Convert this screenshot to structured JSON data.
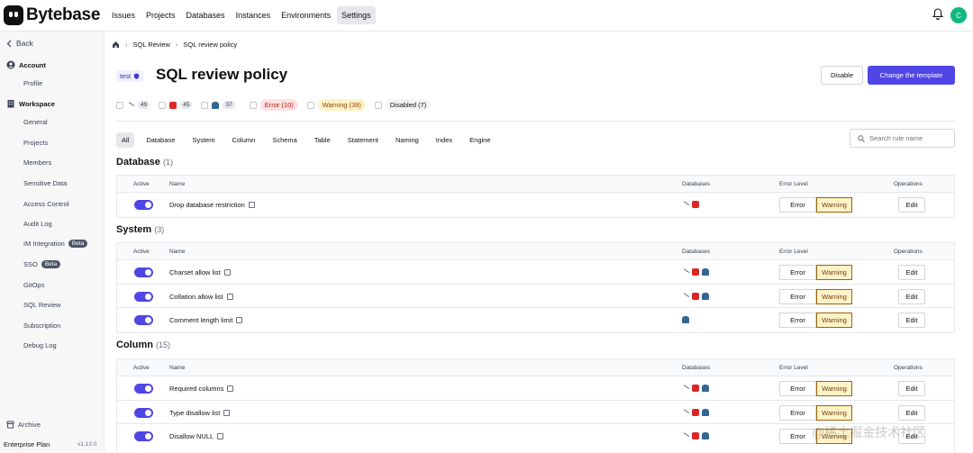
{
  "app": {
    "name": "Bytebase",
    "avatar_letter": "C",
    "accent": "#4f46e5"
  },
  "nav": {
    "items": [
      "Issues",
      "Projects",
      "Databases",
      "Instances",
      "Environments",
      "Settings"
    ],
    "active": "Settings"
  },
  "sidebar": {
    "back": "Back",
    "account": "Account",
    "profile": "Profile",
    "workspace": "Workspace",
    "items": [
      "General",
      "Projects",
      "Members",
      "Sensitive Data",
      "Access Control",
      "Audit Log",
      "IM Integration",
      "SSO",
      "GitOps",
      "SQL Review",
      "Subscription",
      "Debug Log"
    ],
    "beta_label": "Beta",
    "archive": "Archive",
    "plan": "Enterprise Plan",
    "version": "v1.13.0"
  },
  "breadcrumb": {
    "items": [
      "SQL Review",
      "SQL review policy"
    ]
  },
  "page": {
    "env_tag": "test",
    "title": "SQL review policy",
    "disable_label": "Disable",
    "change_label": "Change the template"
  },
  "filters": {
    "engines": [
      {
        "icon": "mysql-icon",
        "count": "49"
      },
      {
        "icon": "tidb-icon",
        "count": "45"
      },
      {
        "icon": "postgres-icon",
        "count": "37"
      }
    ],
    "levels": {
      "error": "Error (10)",
      "warning": "Warning (38)",
      "disabled": "Disabled (7)"
    }
  },
  "tabs": [
    "All",
    "Database",
    "System",
    "Column",
    "Schema",
    "Table",
    "Statement",
    "Naming",
    "Index",
    "Engine"
  ],
  "search": {
    "placeholder": "Search rule name"
  },
  "table_headers": {
    "active": "Active",
    "name": "Name",
    "databases": "Databases",
    "level": "Error Level",
    "ops": "Operations"
  },
  "buttons": {
    "error": "Error",
    "warning": "Warning",
    "edit": "Edit"
  },
  "sections": [
    {
      "title": "Database",
      "count": "(1)",
      "rows": [
        "Drop database restriction"
      ]
    },
    {
      "title": "System",
      "count": "(3)",
      "rows": [
        "Charset allow list",
        "Collation allow list",
        "Comment length limit"
      ]
    },
    {
      "title": "Column",
      "count": "(15)",
      "rows": [
        "Required columns",
        "Type disallow list",
        "Disallow NULL"
      ]
    }
  ],
  "watermark": "@稀土掘金技术社区"
}
